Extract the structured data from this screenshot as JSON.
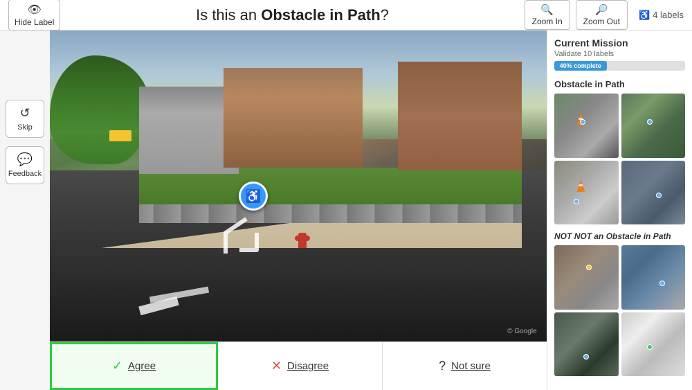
{
  "header": {
    "hide_label_btn": "Hide Label",
    "question": "Is this an ",
    "question_bold": "Obstacle in Path",
    "question_suffix": "?",
    "zoom_in_label": "Zoom In",
    "zoom_out_label": "Zoom Out",
    "label_count": "4 labels",
    "wheelchair_icon": "♿"
  },
  "sidebar": {
    "skip_label": "Skip",
    "feedback_label": "Feedback"
  },
  "answer_buttons": {
    "agree_symbol": "✓",
    "agree_label": "Agree",
    "disagree_symbol": "✕",
    "disagree_label": "Disagree",
    "not_sure_symbol": "?",
    "not_sure_label": "Not sure"
  },
  "right_panel": {
    "current_mission_title": "Current Mission",
    "mission_subtitle": "Validate 10 labels",
    "progress_percent": 40,
    "progress_label": "40% complete",
    "obstacle_section_title": "Obstacle in Path",
    "not_obstacle_section_title": "NOT an Obstacle in Path"
  },
  "icons": {
    "eye": "👁",
    "zoom_in": "🔍",
    "zoom_out": "🔍",
    "skip": "↺",
    "feedback": "💬"
  }
}
